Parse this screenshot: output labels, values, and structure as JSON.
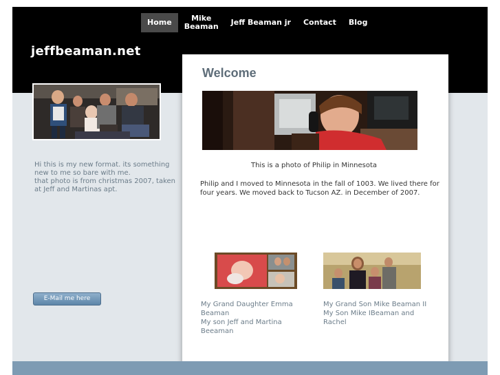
{
  "nav": {
    "items": [
      {
        "label": "Home",
        "active": true
      },
      {
        "label": "Mike\nBeaman",
        "active": false
      },
      {
        "label": "Jeff Beaman jr",
        "active": false
      },
      {
        "label": "Contact",
        "active": false
      },
      {
        "label": "Blog",
        "active": false
      }
    ]
  },
  "site": {
    "title": "jeffbeaman.net"
  },
  "sidebar": {
    "lines": [
      "Hi this is my new format. its something new to me so bare with me.",
      "that photo is from christmas 2007, taken at Jeff and Martinas apt."
    ],
    "email_button": "E-Mail me here"
  },
  "main": {
    "heading": "Welcome",
    "photo_caption": "This is a photo of Philip in Minnesota",
    "story": "Philip and I moved to Minnesota in the fall of 1003. We lived there for four years. We moved back to Tucson AZ. in December of 2007.",
    "thumbs": [
      {
        "lines": [
          "My Grand Daughter Emma Beaman",
          "My son Jeff and Martina Beeaman"
        ]
      },
      {
        "lines": [
          "My Grand Son Mike Beaman II",
          "My Son Mike IBeaman and Rachel"
        ]
      }
    ]
  },
  "colors": {
    "header": "#000000",
    "page_bg": "#e2e7eb",
    "footer": "#7e9bb3",
    "heading": "#5e6d79",
    "sidebar_text": "#6b7c89"
  }
}
